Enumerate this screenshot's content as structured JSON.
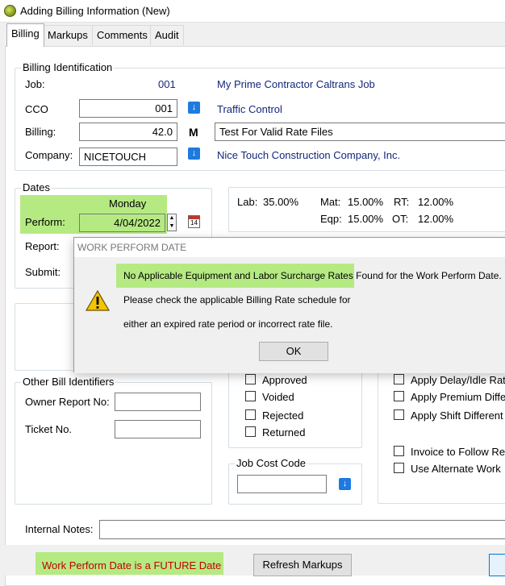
{
  "window": {
    "title": "Adding Billing Information  (New)"
  },
  "tabs": [
    {
      "label": "Billing",
      "active": true
    },
    {
      "label": "Markups"
    },
    {
      "label": "Comments"
    },
    {
      "label": "Audit"
    }
  ],
  "billing_identification": {
    "group_label": "Billing Identification",
    "job_label": "Job:",
    "job_value": "001",
    "job_desc": "My Prime Contractor Caltrans Job",
    "cco_label": "CCO",
    "cco_value": "001",
    "cco_desc": "Traffic Control",
    "billing_label": "Billing:",
    "billing_value": "42.0",
    "billing_flag": "M",
    "billing_desc": "Test For Valid Rate Files",
    "company_label": "Company:",
    "company_value": "NICETOUCH",
    "company_desc": "Nice Touch Construction Company, Inc."
  },
  "dates": {
    "group_label": "Dates",
    "day_name": "Monday",
    "perform_label": "Perform:",
    "perform_value": "4/04/2022",
    "report_label": "Report:",
    "submit_label": "Submit:"
  },
  "rates": {
    "lab_label": "Lab:",
    "lab_value": "35.00%",
    "mat_label": "Mat:",
    "mat_value": "15.00%",
    "rt_label": "RT:",
    "rt_value": "12.00%",
    "eqp_label": "Eqp:",
    "eqp_value": "15.00%",
    "ot_label": "OT:",
    "ot_value": "12.00%"
  },
  "other_bill": {
    "group_label": "Other Bill Identifiers",
    "owner_report_label": "Owner Report No:",
    "ticket_label": "Ticket No."
  },
  "status_checks": [
    {
      "label": "Approved"
    },
    {
      "label": "Voided"
    },
    {
      "label": "Rejected"
    },
    {
      "label": "Returned"
    }
  ],
  "options": [
    {
      "label": "Apply Delay/Idle Rat"
    },
    {
      "label": "Apply Premium Diffe"
    },
    {
      "label": "Apply Shift Different"
    },
    {
      "label": "Invoice to Follow Re"
    },
    {
      "label": "Use Alternate Work"
    }
  ],
  "job_cost": {
    "group_label": "Job Cost Code"
  },
  "internal_notes": {
    "label": "Internal Notes:"
  },
  "footer": {
    "warning": "Work Perform Date is a FUTURE Date",
    "refresh_label": "Refresh Markups"
  },
  "dialog": {
    "title": "WORK PERFORM DATE",
    "line1": "No Applicable Equipment and Labor Surcharge Rates Found for the Work Perform Date.",
    "line2": "Please check the applicable Billing Rate schedule for",
    "line3": "either an expired rate period or incorrect rate file.",
    "ok_label": "OK"
  },
  "colors": {
    "highlight": "#b5ea82",
    "link_blue": "#14287a",
    "warning_red": "#c00000",
    "dropdown_blue": "#1f7ae0"
  }
}
